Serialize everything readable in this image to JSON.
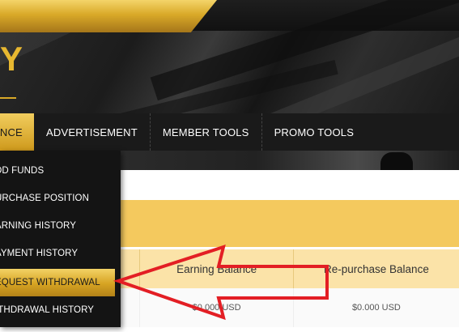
{
  "logo": {
    "text": "Y"
  },
  "nav": {
    "items": [
      {
        "label": "ANCE"
      },
      {
        "label": "ADVERTISEMENT"
      },
      {
        "label": "MEMBER TOOLS"
      },
      {
        "label": "PROMO TOOLS"
      }
    ]
  },
  "dropdown": {
    "items": [
      {
        "label": "DD FUNDS"
      },
      {
        "label": "URCHASE POSITION"
      },
      {
        "label": "ARNING HISTORY"
      },
      {
        "label": "AYMENT HISTORY"
      },
      {
        "label": "EQUEST WITHDRAWAL"
      },
      {
        "label": "ITHDRAWAL HISTORY"
      }
    ],
    "active_index": 4
  },
  "table": {
    "headers": [
      "Earning Balance",
      "Re-purchase Balance"
    ],
    "row": [
      "$0.000 USD",
      "$0.000 USD"
    ]
  },
  "colors": {
    "gold": "#f4c95e",
    "arrow": "#e31e24",
    "dark": "#1a1a1a"
  }
}
